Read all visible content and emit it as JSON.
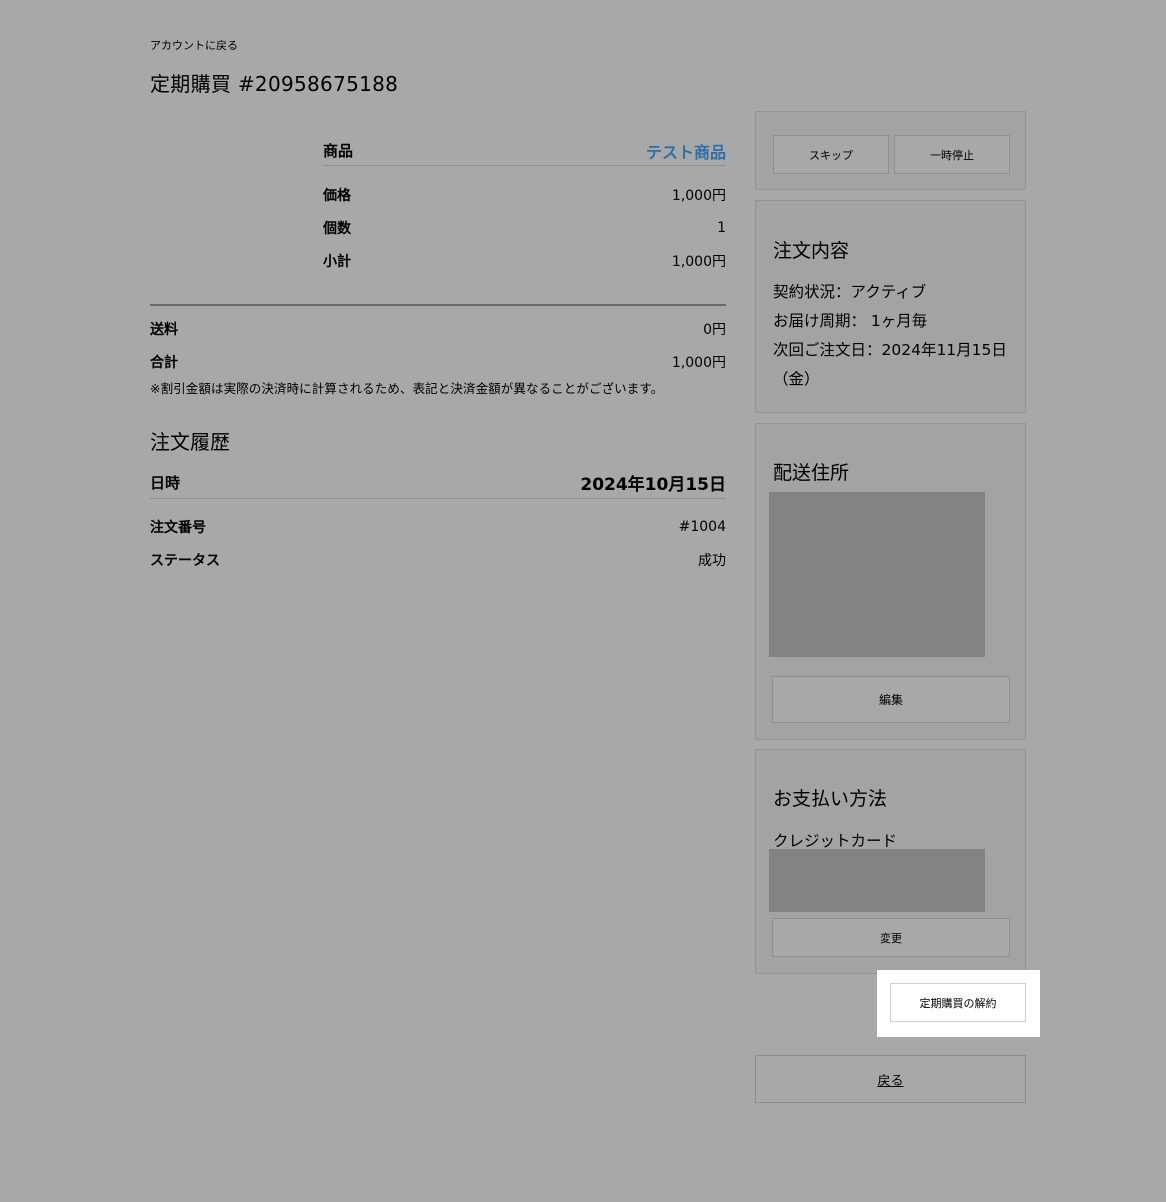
{
  "header": {
    "back_link": "アカウントに戻る",
    "title": "定期購買 #20958675188"
  },
  "product": {
    "label": "商品",
    "name": "テスト商品",
    "rows": [
      {
        "label": "価格",
        "value": "1,000円"
      },
      {
        "label": "個数",
        "value": "1"
      },
      {
        "label": "小計",
        "value": "1,000円"
      }
    ]
  },
  "totals": {
    "rows": [
      {
        "label": "送料",
        "value": "0円"
      },
      {
        "label": "合計",
        "value": "1,000円"
      }
    ],
    "note": "※割引金額は実際の決済時に計算されるため、表記と決済金額が異なることがございます。"
  },
  "history": {
    "title": "注文履歴",
    "date_label": "日時",
    "date_value": "2024年10月15日",
    "rows": [
      {
        "label": "注文番号",
        "value": "#1004"
      },
      {
        "label": "ステータス",
        "value": "成功"
      }
    ]
  },
  "actions": {
    "skip": "スキップ",
    "pause": "一時停止"
  },
  "order": {
    "title": "注文内容",
    "status": "契約状況：アクティブ",
    "cycle": "お届け周期： 1ヶ月毎",
    "next": "次回ご注文日：2024年11月15日（金）"
  },
  "address": {
    "title": "配送住所",
    "edit": "編集"
  },
  "payment": {
    "title": "お支払い方法",
    "method": "クレジットカード",
    "change": "変更"
  },
  "cancel": "定期購買の解約",
  "back": "戻る"
}
